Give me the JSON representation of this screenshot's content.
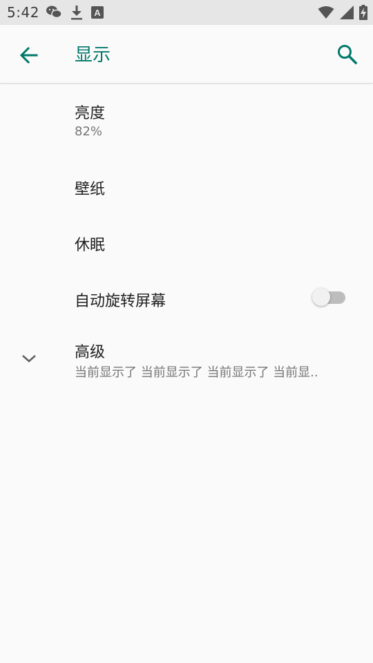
{
  "status_bar": {
    "time": "5:42",
    "left_icons": [
      "wechat-icon",
      "download-icon",
      "a-box-icon"
    ],
    "right_icons": [
      "wifi-icon",
      "signal-icon",
      "battery-charging-icon"
    ]
  },
  "app_bar": {
    "title": "显示",
    "back_icon": "arrow-left-icon",
    "search_icon": "search-icon",
    "accent_color": "#00796b"
  },
  "settings": {
    "brightness": {
      "title": "亮度",
      "value": "82%"
    },
    "wallpaper": {
      "title": "壁纸"
    },
    "sleep": {
      "title": "休眠"
    },
    "auto_rotate": {
      "title": "自动旋转屏幕",
      "toggle_on": false
    },
    "advanced": {
      "title": "高级",
      "summary": "当前显示了 当前显示了 当前显示了 当前显..",
      "icon": "chevron-down-icon"
    }
  }
}
